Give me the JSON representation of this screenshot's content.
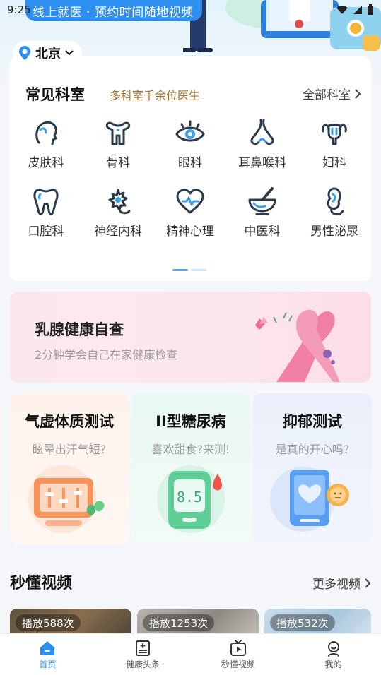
{
  "status_bar": {
    "time": "9:25"
  },
  "banner": {
    "text": "线上就医 · 预约时间随地视频"
  },
  "location": {
    "city": "北京"
  },
  "departments": {
    "title": "常见科室",
    "subtitle": "多科室千余位医生",
    "all_label": "全部科室",
    "items": [
      {
        "label": "皮肤科",
        "icon": "skin-icon"
      },
      {
        "label": "骨科",
        "icon": "bone-icon"
      },
      {
        "label": "眼科",
        "icon": "eye-icon"
      },
      {
        "label": "耳鼻喉科",
        "icon": "nose-icon"
      },
      {
        "label": "妇科",
        "icon": "uterus-icon"
      },
      {
        "label": "口腔科",
        "icon": "tooth-icon"
      },
      {
        "label": "神经内科",
        "icon": "neuron-icon"
      },
      {
        "label": "精神心理",
        "icon": "heart-pulse-icon"
      },
      {
        "label": "中医科",
        "icon": "mortar-icon"
      },
      {
        "label": "男性泌尿",
        "icon": "male-urology-icon"
      }
    ]
  },
  "breast_banner": {
    "title": "乳腺健康自查",
    "subtitle": "2分钟学会自己在家健康检查"
  },
  "tests": [
    {
      "title": "气虚体质测试",
      "subtitle": "眩晕出汗气短?"
    },
    {
      "title": "II型糖尿病",
      "subtitle": "喜欢甜食?来测!",
      "display_value": "8.5"
    },
    {
      "title": "抑郁测试",
      "subtitle": "是真的开心吗?"
    }
  ],
  "videos": {
    "title": "秒懂视频",
    "more_label": "更多视频",
    "items": [
      {
        "plays": "播放588次"
      },
      {
        "plays": "播放1253次"
      },
      {
        "plays": "播放532次"
      }
    ]
  },
  "nav": {
    "items": [
      {
        "label": "首页",
        "icon": "home-icon",
        "active": true
      },
      {
        "label": "健康头条",
        "icon": "news-icon"
      },
      {
        "label": "秒懂视频",
        "icon": "video-icon"
      },
      {
        "label": "我的",
        "icon": "profile-icon"
      }
    ]
  },
  "colors": {
    "primary": "#2e8ff0",
    "accent_gold": "#a0702c",
    "icon_stroke": "#2a3b4c",
    "icon_accent": "#3aa0e8"
  }
}
